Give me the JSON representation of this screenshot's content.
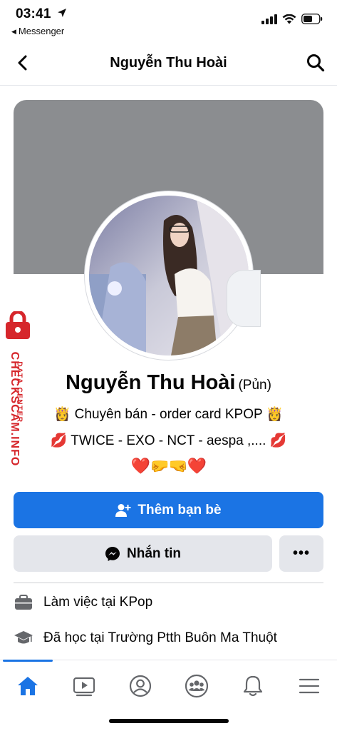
{
  "status_bar": {
    "time": "03:41",
    "back_app": "Messenger"
  },
  "nav": {
    "title": "Nguyễn Thu Hoài"
  },
  "profile": {
    "name": "Nguyễn Thu Hoài",
    "alt_name": "(Pủn)",
    "bio_line1": "👸 Chuyên bán - order card KPOP 👸",
    "bio_line2": "💋 TWICE - EXO - NCT - aespa ,.... 💋",
    "bio_line3": "❤️🤛🤜❤️"
  },
  "watermark": {
    "brand": "CHECKSCAM.INFO",
    "sub": "DATA CENTER"
  },
  "actions": {
    "add_friend": "Thêm bạn bè",
    "message": "Nhắn tin",
    "more": "•••"
  },
  "info": {
    "work": "Làm việc tại KPop",
    "education": "Đã học tại Trường Ptth Buôn Ma Thuột"
  },
  "tabs": [
    "home-icon",
    "video-icon",
    "profile-icon",
    "groups-icon",
    "bell-icon",
    "menu-icon"
  ],
  "colors": {
    "accent": "#1b74e4",
    "cover": "#8b8d90",
    "secondary_button": "#e4e6eb",
    "watermark": "#d6262b"
  }
}
